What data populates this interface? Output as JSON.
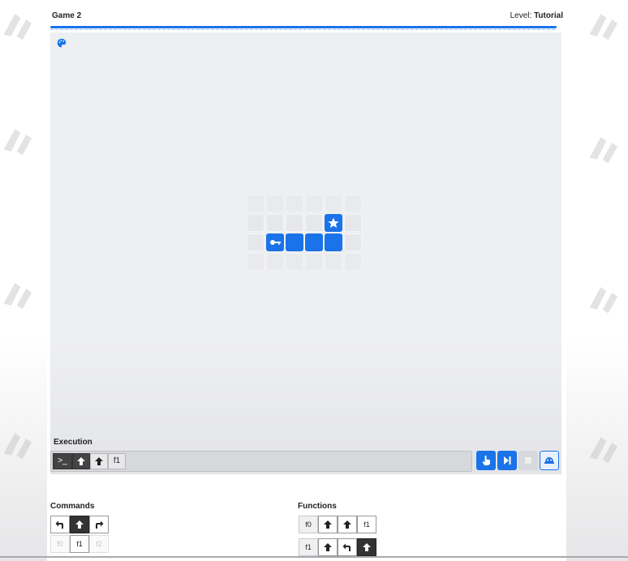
{
  "header": {
    "title": "Game 2",
    "level_label": "Level:",
    "level_value": "Tutorial"
  },
  "board": {
    "palette_icon": "palette-icon",
    "tiles": [
      {
        "row": 1,
        "col": 4,
        "type": "goal",
        "icon": "star-icon"
      },
      {
        "row": 2,
        "col": 1,
        "type": "robot",
        "icon": "robot-icon"
      },
      {
        "row": 2,
        "col": 2,
        "type": "path"
      },
      {
        "row": 2,
        "col": 3,
        "type": "path"
      },
      {
        "row": 2,
        "col": 4,
        "type": "path"
      }
    ]
  },
  "execution": {
    "label": "Execution",
    "slots": [
      {
        "icon": "terminal-icon",
        "text": ">_",
        "dark": true
      },
      {
        "icon": "arrow-up-icon",
        "dark": true
      },
      {
        "icon": "arrow-up-icon",
        "dark": false
      },
      {
        "text": "f1",
        "dark": false
      }
    ],
    "controls": [
      "pointer-hand-icon",
      "step-forward-icon",
      "stop-icon",
      "helmet-icon"
    ]
  },
  "commands": {
    "label": "Commands",
    "row1": [
      "turn-left-icon",
      "arrow-up-icon",
      "turn-right-icon"
    ],
    "row2": [
      "f0",
      "f1",
      "f2"
    ]
  },
  "functions": {
    "label": "Functions",
    "f0": {
      "name": "f0",
      "steps": [
        "arrow-up-icon",
        "arrow-up-icon",
        "f1"
      ]
    },
    "f1": {
      "name": "f1",
      "steps": [
        "arrow-up-icon",
        "turn-left-icon",
        "arrow-up-icon"
      ]
    }
  },
  "colors": {
    "accent": "#1a73e8",
    "board": "#eeeff1",
    "dark_slot": "#333333"
  }
}
